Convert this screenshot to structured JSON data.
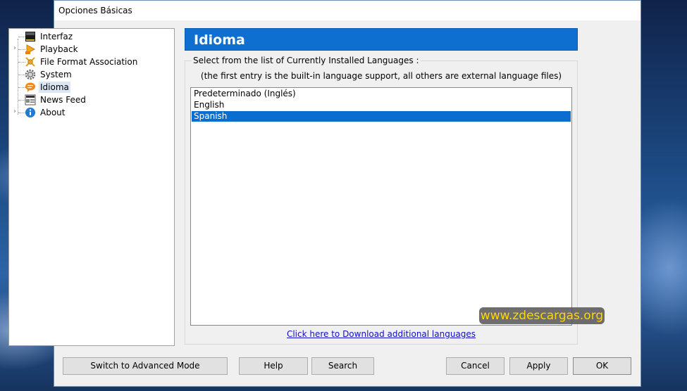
{
  "window": {
    "title": "Opciones Básicas"
  },
  "tree": {
    "items": [
      {
        "label": "Interfaz",
        "icon": "interface-icon",
        "expandable": false,
        "selected": false
      },
      {
        "label": "Playback",
        "icon": "playback-icon",
        "expandable": true,
        "selected": false
      },
      {
        "label": "File Format Association",
        "icon": "file-format-icon",
        "expandable": false,
        "selected": false
      },
      {
        "label": "System",
        "icon": "gear-icon",
        "expandable": false,
        "selected": false
      },
      {
        "label": "Idioma",
        "icon": "language-icon",
        "expandable": false,
        "selected": true
      },
      {
        "label": "News Feed",
        "icon": "news-icon",
        "expandable": false,
        "selected": false
      },
      {
        "label": "About",
        "icon": "info-icon",
        "expandable": true,
        "selected": false
      }
    ]
  },
  "panel": {
    "title": "Idioma",
    "group_label": "Select from the list of Currently Installed Languages :",
    "note": "(the first entry is the built-in language support, all others are external language files)",
    "languages": [
      "Predeterminado (Inglés)",
      "English",
      "Spanish"
    ],
    "selected_language": "Spanish",
    "download_link": "Click here to Download additional languages"
  },
  "watermark": "www.zdescargas.org",
  "buttons": {
    "advanced": "Switch to Advanced Mode",
    "help": "Help",
    "search": "Search",
    "cancel": "Cancel",
    "apply": "Apply",
    "ok": "OK"
  },
  "colors": {
    "banner": "#0f6fd0",
    "selection": "#0a6ed1",
    "link": "#1010c8",
    "watermark_text": "#ffd700"
  }
}
